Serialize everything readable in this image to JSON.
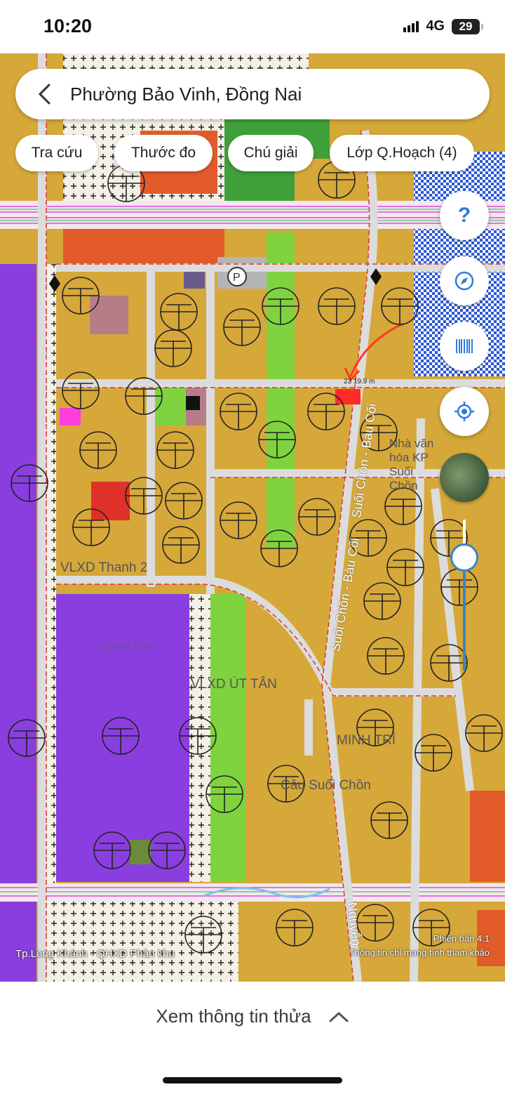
{
  "status_bar": {
    "time": "10:20",
    "network": "4G",
    "battery": "29"
  },
  "search": {
    "location": "Phường Bảo Vinh, Đồng Nai"
  },
  "chips": [
    {
      "label": "Tra cứu"
    },
    {
      "label": "Thước đo"
    },
    {
      "label": "Chú giải"
    },
    {
      "label": "Lớp Q.Hoạch (4)"
    }
  ],
  "map": {
    "road_labels": [
      "Suối Chồn - Bàu Cối",
      "Suối Chồn - Bàu Cối",
      "Nguyễn"
    ],
    "poi_labels": [
      "VLXD Thanh 2",
      "VLXD ÚT TÂN",
      "Câu Suối Chồn",
      "MINH TRÍ",
      "Nhà văn hóa KP Suối Chồn"
    ],
    "watermark": "qhviet.com",
    "measurement": "23 19.9 m",
    "colors": {
      "residential": "#d6a83a",
      "education": "#8a3ee0",
      "green": "#7fd33f",
      "commercial": "#e35b2b",
      "water": "#2e5fd8"
    }
  },
  "captions": {
    "left": "Tp.Long Khánh - QHXD Phân khu",
    "version": "Phiên bản 4.1",
    "disclaimer": "Thông tin chỉ mang tính tham khảo"
  },
  "bottom": {
    "label": "Xem thông tin thửa"
  }
}
